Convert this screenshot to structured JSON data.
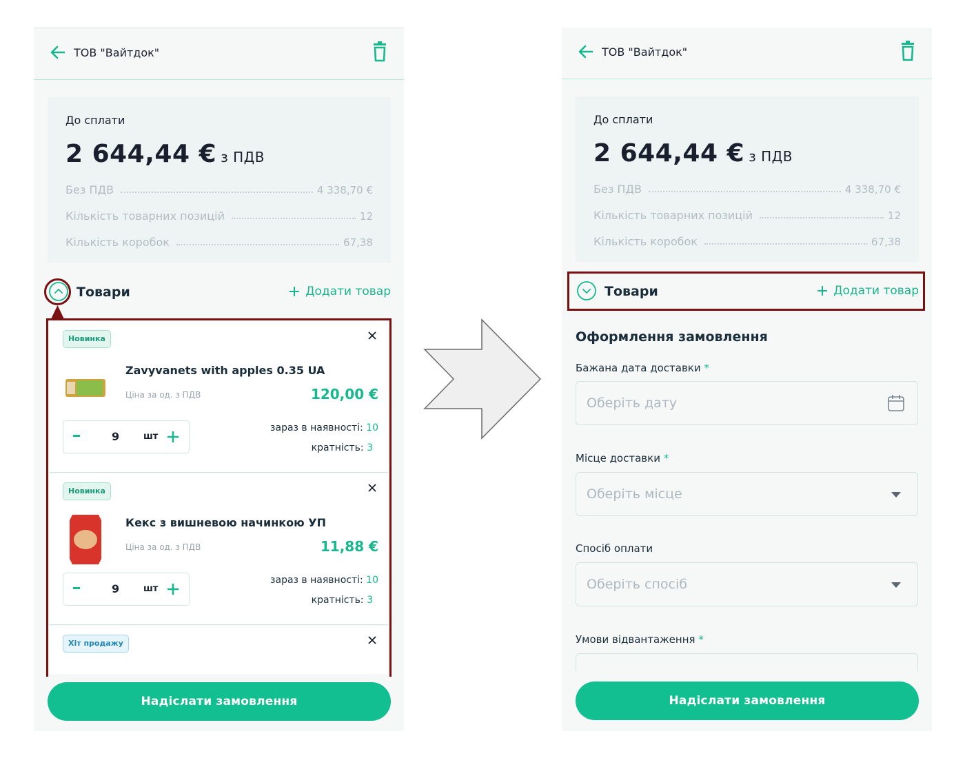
{
  "company": "ТОВ \"Вайтдок\"",
  "summary": {
    "pay_label": "До сплати",
    "total": "2 644,44 €",
    "vat_note": "з ПДВ",
    "rows": [
      {
        "label": "Без ПДВ",
        "value": "4 338,70 €"
      },
      {
        "label": "Кількість товарних позицій",
        "value": "12"
      },
      {
        "label": "Кількість коробок",
        "value": "67,38"
      }
    ]
  },
  "goods": {
    "title": "Товари",
    "add_label": "Додати товар"
  },
  "products": [
    {
      "badge": "Новинка",
      "name": "Zavyvanets with apples 0.35 UA",
      "price_label": "Ціна за од. з ПДВ",
      "price": "120,00 €",
      "qty": "9",
      "unit": "шт",
      "stock_label": "зараз в наявності:",
      "stock": "10",
      "mult_label": "кратність:",
      "mult": "3"
    },
    {
      "badge": "Новинка",
      "name": "Кекс з вишневою начинкою УП",
      "price_label": "Ціна за од. з ПДВ",
      "price": "11,88 €",
      "qty": "9",
      "unit": "шт",
      "stock_label": "зараз в наявності:",
      "stock": "10",
      "mult_label": "кратність:",
      "mult": "3"
    },
    {
      "badge": "Хіт продажу"
    }
  ],
  "submit_label": "Надіслати замовлення",
  "form": {
    "title": "Оформлення замовлення",
    "delivery_date_label": "Бажана дата доставки",
    "delivery_date_placeholder": "Оберіть дату",
    "place_label": "Місце доставки",
    "place_placeholder": "Оберіть місце",
    "payment_label": "Спосіб оплати",
    "payment_placeholder": "Оберіть спосіб",
    "shipping_label": "Умови відвантаження",
    "required_mark": "*"
  },
  "colors": {
    "accent": "#12bf91",
    "highlight": "#7a1010",
    "summary_bg": "#edf4f3"
  }
}
